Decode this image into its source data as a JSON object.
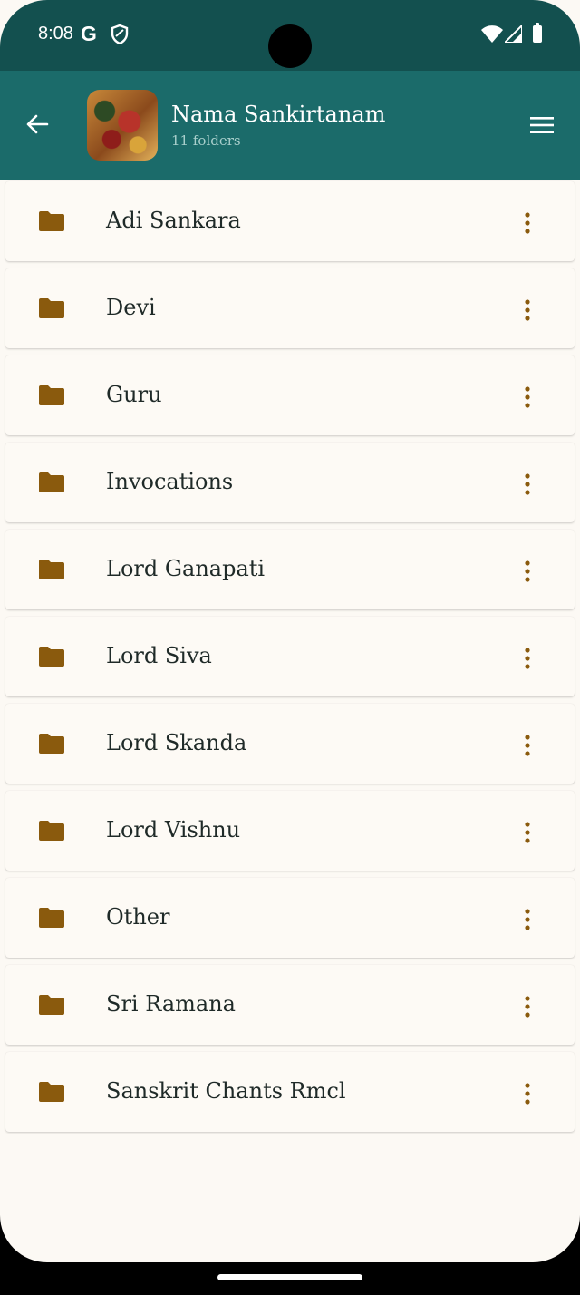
{
  "status_bar": {
    "time": "8:08",
    "g_letter": "G",
    "icons": [
      "google-icon",
      "shield-icon",
      "wifi-icon",
      "signal-icon",
      "battery-icon"
    ]
  },
  "app_bar": {
    "title": "Nama Sankirtanam",
    "subtitle": "11 folders",
    "icons": [
      "back-arrow-icon",
      "menu-icon"
    ],
    "color": "#1b6b6a"
  },
  "folders": [
    {
      "label": "Adi Sankara"
    },
    {
      "label": "Devi"
    },
    {
      "label": "Guru"
    },
    {
      "label": "Invocations"
    },
    {
      "label": "Lord Ganapati"
    },
    {
      "label": "Lord Siva"
    },
    {
      "label": "Lord Skanda"
    },
    {
      "label": "Lord Vishnu"
    },
    {
      "label": "Other"
    },
    {
      "label": "Sri Ramana"
    },
    {
      "label": "Sanskrit Chants Rmcl"
    }
  ],
  "colors": {
    "status_bar": "#13504f",
    "folder_icon": "#8a5a0d",
    "background": "#fcf9f4"
  }
}
